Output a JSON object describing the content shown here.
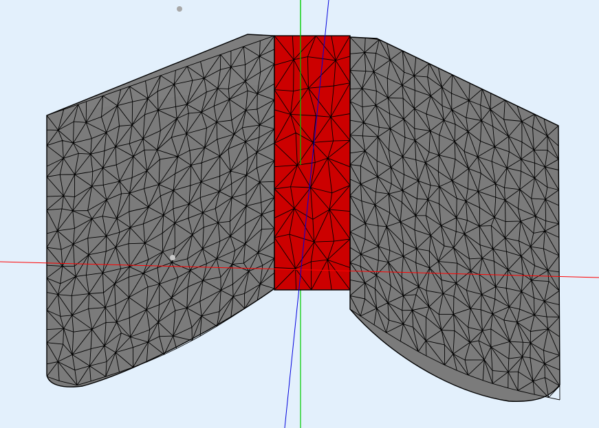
{
  "viewport": {
    "background_color": "#e3f0fc"
  },
  "mesh": {
    "face_color_gray": "#7b7b7b",
    "face_color_gray_side": "#737373",
    "face_color_red": "#cc0000",
    "edge_color": "#000000"
  },
  "axes": {
    "x_axis_color": "#ff0000",
    "y_axis_color": "#00cc00",
    "z_axis_color": "#0000dd"
  }
}
